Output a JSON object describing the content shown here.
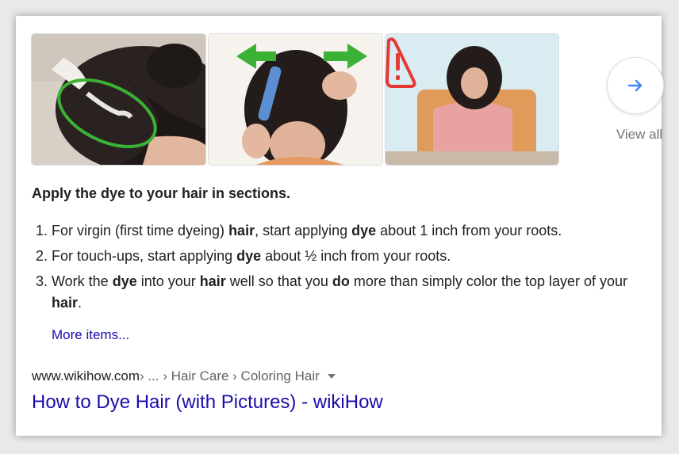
{
  "images": [
    {
      "alt": "applying dye to hair roots"
    },
    {
      "alt": "parting hair with comb"
    },
    {
      "alt": "woman seated warning"
    }
  ],
  "icons": {
    "view_all": "arrow-right-icon",
    "image3_warning": "warning-icon",
    "image2_arrows": "double-arrow-icon"
  },
  "view_all_label": "View all",
  "heading": "Apply the dye to your hair in sections.",
  "steps": [
    {
      "parts": [
        "For virgin (first time dyeing) ",
        "hair",
        ", start applying ",
        "dye",
        " about 1 inch from your roots."
      ]
    },
    {
      "parts": [
        "For touch-ups, start applying ",
        "dye",
        " about ½ inch from your roots."
      ]
    },
    {
      "parts": [
        "Work the ",
        "dye",
        " into your ",
        "hair",
        " well so that you ",
        "do",
        " more than simply color the top layer of your ",
        "hair",
        "."
      ]
    }
  ],
  "more_items": "More items...",
  "breadcrumb": {
    "domain": "www.wikihow.com",
    "path": " › ... › Hair Care › Coloring Hair"
  },
  "result_title": "How to Dye Hair (with Pictures) - wikiHow",
  "colors": {
    "link": "#1a0dab",
    "arrow_green": "#3bb135",
    "warning_red": "#e53935",
    "view_all_arrow": "#4285f4"
  }
}
